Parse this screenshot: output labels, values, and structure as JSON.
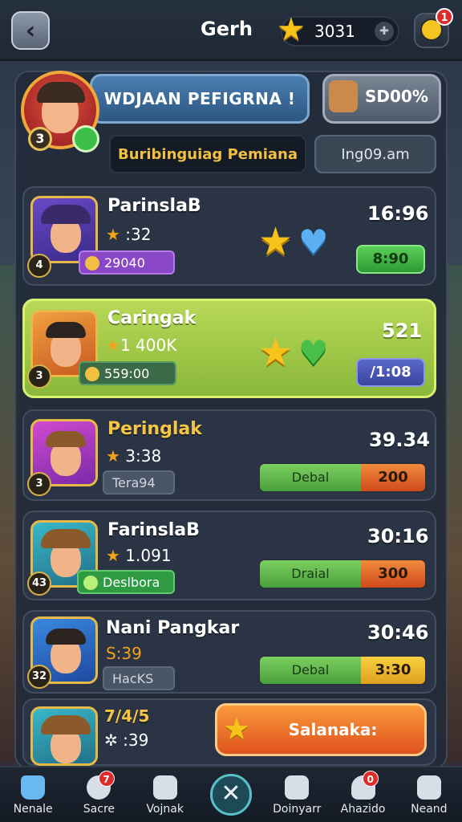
{
  "topbar": {
    "title": "Gerh",
    "currency_value": "3031",
    "back_icon": "chevron-left-icon",
    "add_icon": "plus-icon",
    "notification_badge": "1"
  },
  "header": {
    "banner_text": "WDJAAN PEFIGRNA !",
    "hero_level": "3",
    "score_text": "SD00%",
    "subtitle": "Buribinguiag Pemiana",
    "time_text": "Ing09.am"
  },
  "players": [
    {
      "name": "ParinslaB",
      "score": "32",
      "score_prefix": ":",
      "tag": "29040",
      "time": "16:96",
      "button": "8:90",
      "rank": "4",
      "heart_color": "#5ab0f0"
    },
    {
      "name": "Caringak",
      "score": "1 400K",
      "tag": "559:00",
      "time": "521",
      "button": "/1:08",
      "rank": "3",
      "heart_color": "#48c048"
    },
    {
      "name": "Peringlak",
      "score": "3:38",
      "tag": "Tera94",
      "time": "39.34",
      "split_label": "Debal",
      "split_value": "200",
      "rank": "3"
    },
    {
      "name": "FarinslaB",
      "score": "1.091",
      "tag": "Deslbora",
      "time": "30:16",
      "split_label": "Draial",
      "split_value": "300",
      "rank": "43"
    },
    {
      "name": "Nani Pangkar",
      "score": "S:39",
      "tag": "HacKS",
      "time": "30:46",
      "split_label": "Debal",
      "split_value": "3:30",
      "rank": "32"
    },
    {
      "name": "7/4/5",
      "score": "39",
      "score_prefix": "✲ :"
    }
  ],
  "collect_button": "Salanaka:",
  "nav": [
    {
      "label": "Nenale",
      "icon": "home-icon"
    },
    {
      "label": "Sacre",
      "icon": "profile-icon",
      "badge": "7"
    },
    {
      "label": "Vojnak",
      "icon": "list-icon"
    },
    {
      "label": "",
      "icon": "close-icon"
    },
    {
      "label": "Doinyarr",
      "icon": "bag-icon"
    },
    {
      "label": "Ahazido",
      "icon": "friends-icon",
      "badge": "0"
    },
    {
      "label": "Neand",
      "icon": "menu-icon"
    }
  ]
}
